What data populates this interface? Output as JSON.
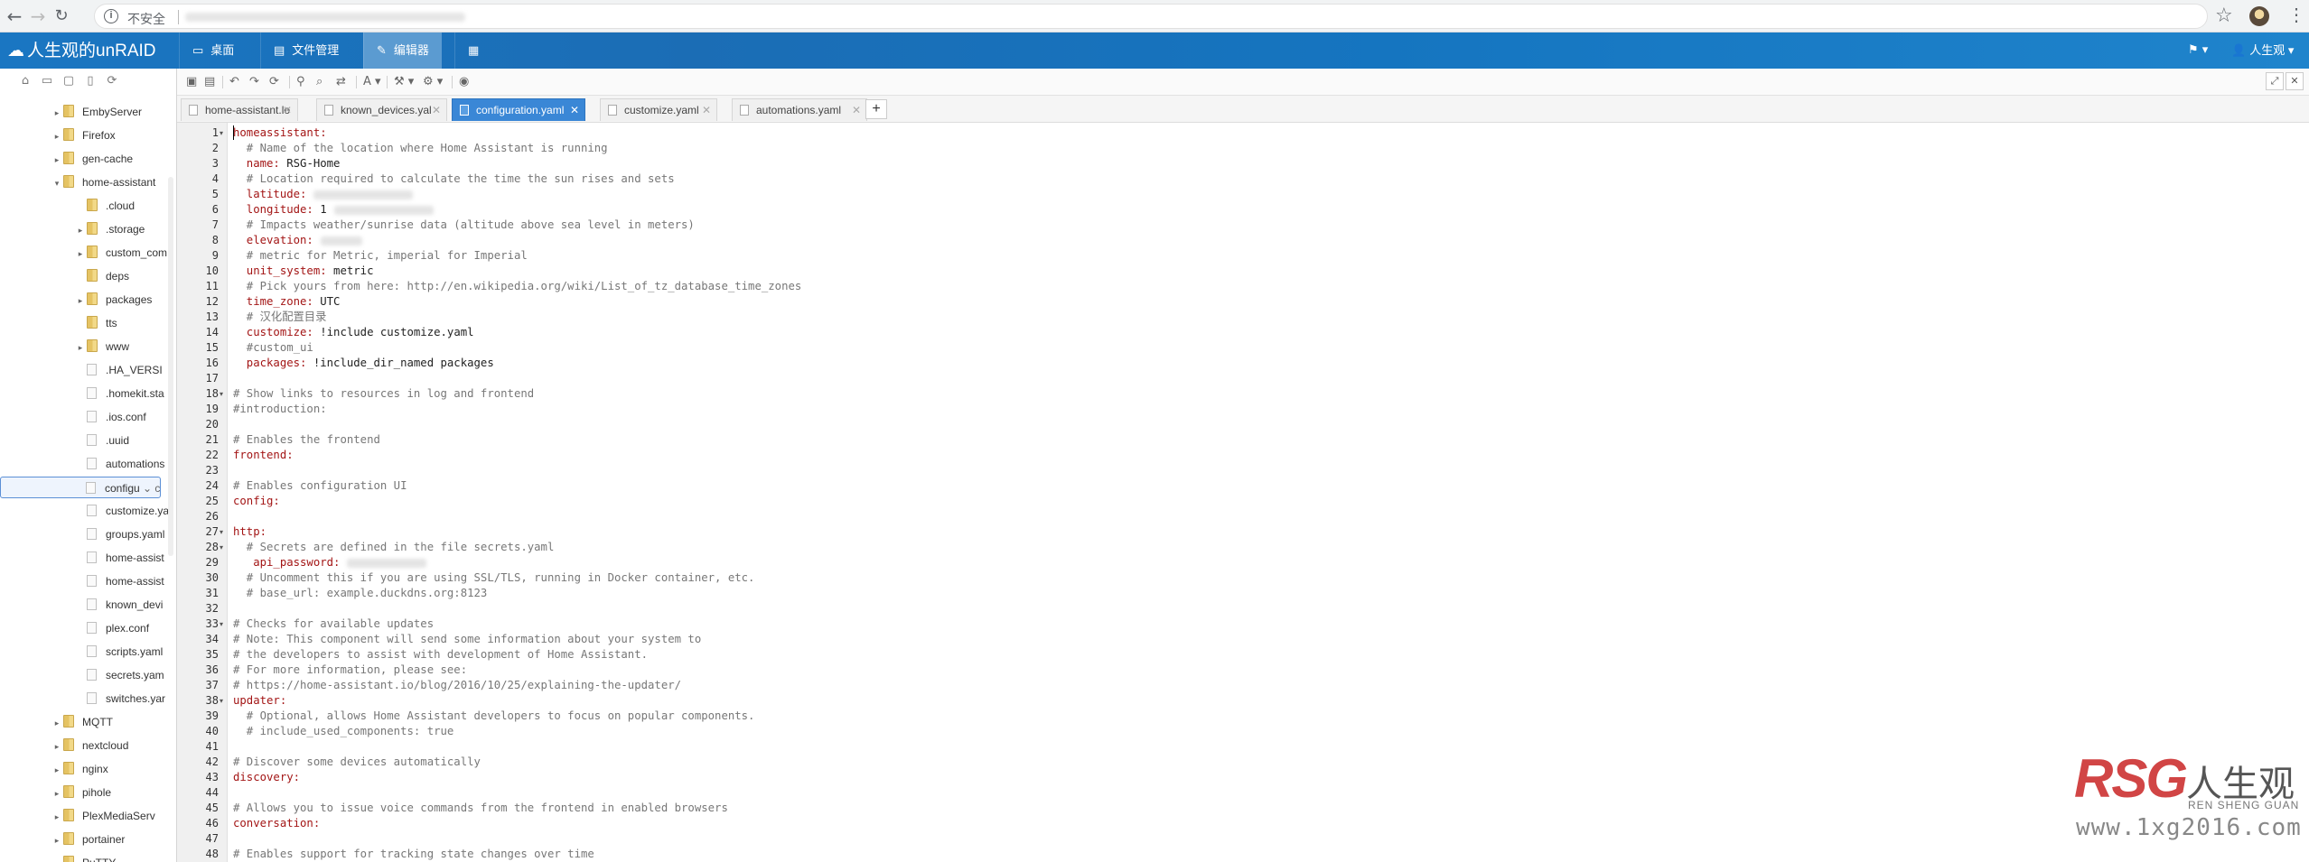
{
  "browser": {
    "security_label": "不安全"
  },
  "app": {
    "logo": "人生观的unRAID",
    "nav_tabs": [
      {
        "icon": "desktop-icon",
        "label": "桌面"
      },
      {
        "icon": "folder-icon",
        "label": "文件管理"
      },
      {
        "icon": "edit-icon",
        "label": "编辑器"
      },
      {
        "icon": "grid-icon",
        "label": ""
      }
    ],
    "user": "人生观"
  },
  "tree": [
    {
      "name": "EmbyServer",
      "type": "folder",
      "expand": "collapsed",
      "depth": 1
    },
    {
      "name": "Firefox",
      "type": "folder",
      "expand": "collapsed",
      "depth": 1
    },
    {
      "name": "gen-cache",
      "type": "folder",
      "expand": "collapsed",
      "depth": 1
    },
    {
      "name": "home-assistant",
      "type": "folder",
      "expand": "expanded",
      "depth": 1
    },
    {
      "name": ".cloud",
      "type": "folder",
      "expand": "none",
      "depth": 2
    },
    {
      "name": ".storage",
      "type": "folder",
      "expand": "collapsed",
      "depth": 2
    },
    {
      "name": "custom_com",
      "type": "folder",
      "expand": "collapsed",
      "depth": 2
    },
    {
      "name": "deps",
      "type": "folder",
      "expand": "none",
      "depth": 2
    },
    {
      "name": "packages",
      "type": "folder",
      "expand": "collapsed",
      "depth": 2
    },
    {
      "name": "tts",
      "type": "folder",
      "expand": "none",
      "depth": 2
    },
    {
      "name": "www",
      "type": "folder",
      "expand": "collapsed",
      "depth": 2
    },
    {
      "name": ".HA_VERSI",
      "type": "file",
      "expand": "none",
      "depth": 2
    },
    {
      "name": ".homekit.sta",
      "type": "file",
      "expand": "none",
      "depth": 2
    },
    {
      "name": ".ios.conf",
      "type": "file",
      "expand": "none",
      "depth": 2
    },
    {
      "name": ".uuid",
      "type": "file",
      "expand": "none",
      "depth": 2
    },
    {
      "name": "automations",
      "type": "file",
      "expand": "none",
      "depth": 2
    },
    {
      "name": "configu",
      "type": "file",
      "expand": "none",
      "depth": 2,
      "selected": true
    },
    {
      "name": "customize.ya",
      "type": "file",
      "expand": "none",
      "depth": 2
    },
    {
      "name": "groups.yaml",
      "type": "file",
      "expand": "none",
      "depth": 2
    },
    {
      "name": "home-assist",
      "type": "file",
      "expand": "none",
      "depth": 2
    },
    {
      "name": "home-assist",
      "type": "file",
      "expand": "none",
      "depth": 2
    },
    {
      "name": "known_devi",
      "type": "file",
      "expand": "none",
      "depth": 2
    },
    {
      "name": "plex.conf",
      "type": "file",
      "expand": "none",
      "depth": 2
    },
    {
      "name": "scripts.yaml",
      "type": "file",
      "expand": "none",
      "depth": 2
    },
    {
      "name": "secrets.yam",
      "type": "file",
      "expand": "none",
      "depth": 2
    },
    {
      "name": "switches.yar",
      "type": "file",
      "expand": "none",
      "depth": 2
    },
    {
      "name": "MQTT",
      "type": "folder",
      "expand": "collapsed",
      "depth": 1
    },
    {
      "name": "nextcloud",
      "type": "folder",
      "expand": "collapsed",
      "depth": 1
    },
    {
      "name": "nginx",
      "type": "folder",
      "expand": "collapsed",
      "depth": 1
    },
    {
      "name": "pihole",
      "type": "folder",
      "expand": "collapsed",
      "depth": 1
    },
    {
      "name": "PlexMediaServ",
      "type": "folder",
      "expand": "collapsed",
      "depth": 1
    },
    {
      "name": "portainer",
      "type": "folder",
      "expand": "collapsed",
      "depth": 1
    },
    {
      "name": "PuTTY",
      "type": "folder",
      "expand": "collapsed",
      "depth": 1
    }
  ],
  "tabs": [
    {
      "label": "home-assistant.lo",
      "active": false
    },
    {
      "label": "known_devices.yal",
      "active": false
    },
    {
      "label": "configuration.yaml",
      "active": true
    },
    {
      "label": "customize.yaml",
      "active": false
    },
    {
      "label": "automations.yaml",
      "active": false
    }
  ],
  "code_lines": [
    {
      "t": "key",
      "text": "homeassistant:",
      "fold": true
    },
    {
      "t": "com",
      "text": "  # Name of the location where Home Assistant is running"
    },
    {
      "t": "kv",
      "key": "  name:",
      "val": " RSG-Home"
    },
    {
      "t": "com",
      "text": "  # Location required to calculate the time the sun rises and sets"
    },
    {
      "t": "kv",
      "key": "  latitude:",
      "val": "",
      "redacted": true
    },
    {
      "t": "kv",
      "key": "  longitude:",
      "val": " 1",
      "redacted": true
    },
    {
      "t": "com",
      "text": "  # Impacts weather/sunrise data (altitude above sea level in meters)"
    },
    {
      "t": "kv",
      "key": "  elevation:",
      "val": "",
      "redacted": true
    },
    {
      "t": "com",
      "text": "  # metric for Metric, imperial for Imperial"
    },
    {
      "t": "kv",
      "key": "  unit_system:",
      "val": " metric"
    },
    {
      "t": "com",
      "text": "  # Pick yours from here: http://en.wikipedia.org/wiki/List_of_tz_database_time_zones"
    },
    {
      "t": "kv",
      "key": "  time_zone:",
      "val": " UTC"
    },
    {
      "t": "com",
      "text": "  # 汉化配置目录"
    },
    {
      "t": "kv",
      "key": "  customize:",
      "val": " !include customize.yaml"
    },
    {
      "t": "com",
      "text": "  #custom_ui"
    },
    {
      "t": "kv",
      "key": "  packages:",
      "val": " !include_dir_named packages"
    },
    {
      "t": "blank",
      "text": ""
    },
    {
      "t": "com",
      "text": "# Show links to resources in log and frontend",
      "fold": true
    },
    {
      "t": "com",
      "text": "#introduction:"
    },
    {
      "t": "blank",
      "text": ""
    },
    {
      "t": "com",
      "text": "# Enables the frontend"
    },
    {
      "t": "key",
      "text": "frontend:"
    },
    {
      "t": "blank",
      "text": ""
    },
    {
      "t": "com",
      "text": "# Enables configuration UI"
    },
    {
      "t": "key",
      "text": "config:"
    },
    {
      "t": "blank",
      "text": ""
    },
    {
      "t": "key",
      "text": "http:",
      "fold": true
    },
    {
      "t": "com",
      "text": "  # Secrets are defined in the file secrets.yaml",
      "fold": true
    },
    {
      "t": "kv",
      "key": "   api_password:",
      "val": "",
      "redacted": true
    },
    {
      "t": "com",
      "text": "  # Uncomment this if you are using SSL/TLS, running in Docker container, etc."
    },
    {
      "t": "com",
      "text": "  # base_url: example.duckdns.org:8123"
    },
    {
      "t": "blank",
      "text": ""
    },
    {
      "t": "com",
      "text": "# Checks for available updates",
      "fold": true
    },
    {
      "t": "com",
      "text": "# Note: This component will send some information about your system to"
    },
    {
      "t": "com",
      "text": "# the developers to assist with development of Home Assistant."
    },
    {
      "t": "com",
      "text": "# For more information, please see:"
    },
    {
      "t": "com",
      "text": "# https://home-assistant.io/blog/2016/10/25/explaining-the-updater/"
    },
    {
      "t": "key",
      "text": "updater:",
      "fold": true
    },
    {
      "t": "com",
      "text": "  # Optional, allows Home Assistant developers to focus on popular components."
    },
    {
      "t": "com",
      "text": "  # include_used_components: true"
    },
    {
      "t": "blank",
      "text": ""
    },
    {
      "t": "com",
      "text": "# Discover some devices automatically"
    },
    {
      "t": "key",
      "text": "discovery:"
    },
    {
      "t": "blank",
      "text": ""
    },
    {
      "t": "com",
      "text": "# Allows you to issue voice commands from the frontend in enabled browsers"
    },
    {
      "t": "key",
      "text": "conversation:"
    },
    {
      "t": "blank",
      "text": ""
    },
    {
      "t": "com",
      "text": "# Enables support for tracking state changes over time"
    }
  ],
  "watermark": {
    "brand": "RSG",
    "cn": "人生观",
    "pinyin": "REN SHENG GUAN",
    "url": "www.1xg2016.com"
  }
}
